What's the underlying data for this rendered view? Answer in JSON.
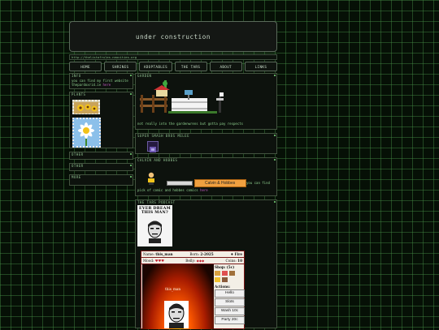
{
  "header": {
    "title": "under construction"
  },
  "url": "http://thelistofrules.neocities.org",
  "nav": [
    "HOME",
    "SHRINES",
    "ADOPTABLES",
    "THE TARS",
    "ABOUT",
    "LINKS"
  ],
  "sidebar": {
    "info": {
      "title": "INFO",
      "text": "you can find my first website",
      "text2": "thepardoxrid.ie",
      "link": "here"
    },
    "plants": {
      "title": "PLANTS"
    },
    "other1": {
      "title": "OTHER"
    },
    "other2": {
      "title": "OTHER"
    },
    "more": {
      "title": "MORE"
    }
  },
  "garden": {
    "title": "GARDEN",
    "text": "not really into the gardenwrens but gotta pay respects"
  },
  "smash": {
    "title": "SUPER SMASH BROS MELEE"
  },
  "calvin": {
    "title": "CALVIN AND HOBBES",
    "banner": "Calvin & Hobbes",
    "text": "you can find",
    "text2": "pick of comic and hobbes comics",
    "link": "here"
  },
  "podcast": {
    "title": "THE TARS PODCAST",
    "img_title": "EVER DREAM THIS MAN?"
  },
  "pet": {
    "name_label": "Name:",
    "name": "this_man",
    "born_label": "Born:",
    "born": "2-2025",
    "element": "Fire",
    "mood_label": "Mood:",
    "mood": "♥♥♥",
    "belly_label": "Belly:",
    "belly": "◆◆◆",
    "coins_label": "Coins:",
    "coins": "10",
    "shop_label": "Shop: (5c)",
    "caption": "this_man",
    "actions_label": "Actions:",
    "actions": [
      "Hello",
      "Slots",
      "Wash 10c",
      "Party 20c"
    ]
  }
}
